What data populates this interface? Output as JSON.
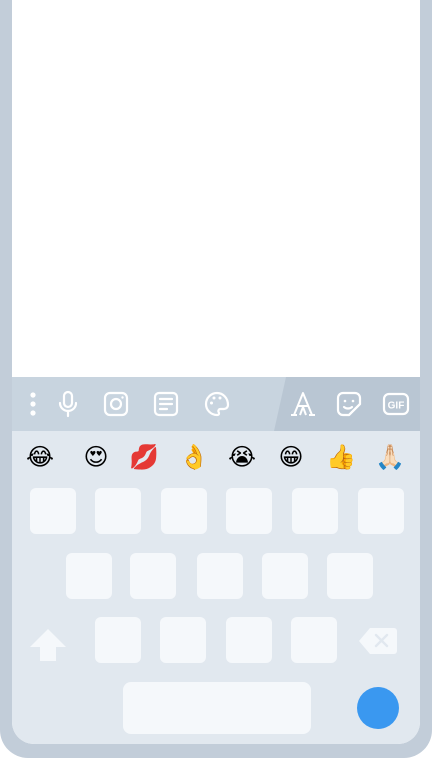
{
  "colors": {
    "frame": "#c2cdd9",
    "toolbar": "#c8d4df",
    "toolbar_right": "#b9c6d3",
    "keyboard": "#e1e8ef",
    "key": "#f5f8fb",
    "icon": "#ffffff",
    "send": "#3a98f0"
  },
  "toolbar": {
    "left_icons": [
      "more-vertical-icon",
      "microphone-icon",
      "instagram-icon",
      "notes-icon",
      "palette-icon"
    ],
    "right_icons": [
      "font-style-icon",
      "sticker-icon",
      "gif-icon"
    ]
  },
  "suggestions": {
    "emojis": [
      "😂",
      "😍",
      "💋",
      "👌",
      "😭",
      "😁",
      "👍",
      "🙏🏻"
    ]
  },
  "keyboard": {
    "row1_keys": 6,
    "row2_keys": 5,
    "row3_keys": 4,
    "special_keys": [
      "shift-icon",
      "backspace-icon",
      "space-bar",
      "send-button"
    ]
  }
}
